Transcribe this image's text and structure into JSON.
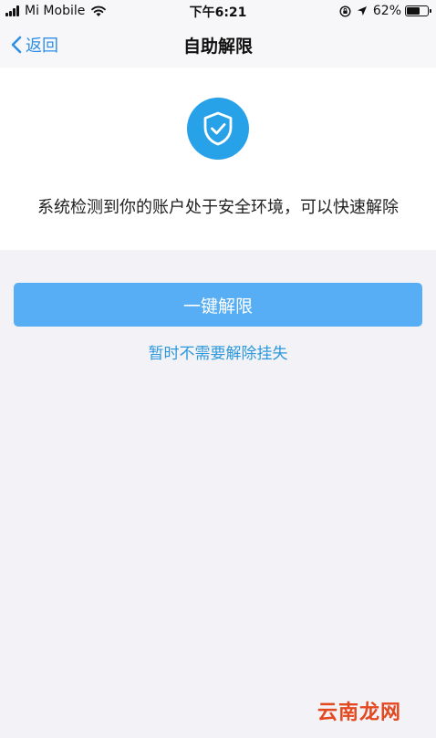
{
  "status_bar": {
    "carrier": "Mi Mobile",
    "time": "下午6:21",
    "battery_percent": "62%",
    "battery_level": 0.62,
    "icons": [
      "signal-icon",
      "wifi-icon",
      "orientation-lock-icon",
      "location-arrow-icon",
      "battery-icon"
    ]
  },
  "nav": {
    "back_label": "返回",
    "title": "自助解限"
  },
  "card": {
    "icon": "shield-check-icon",
    "message": "系统检测到你的账户处于安全环境，可以快速解除"
  },
  "actions": {
    "primary_label": "一键解限",
    "secondary_label": "暂时不需要解除挂失"
  },
  "watermark": {
    "text": "云南龙网"
  },
  "colors": {
    "accent": "#27a1e8",
    "button": "#57aef4",
    "link": "#2c98db",
    "background": "#f3f3f7",
    "watermark": "#e4481f"
  }
}
